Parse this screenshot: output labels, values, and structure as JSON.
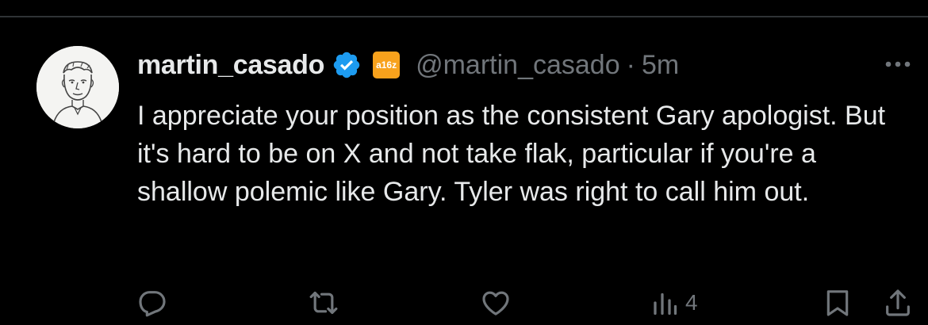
{
  "tweet": {
    "display_name": "martin_casado",
    "handle": "@martin_casado",
    "separator": "·",
    "time": "5m",
    "affiliate_badge_text": "a16z",
    "text": "I appreciate your position as the consistent Gary apologist. But it's hard to be on X and not take flak, particular if you're a shallow polemic like Gary. Tyler was right to call him out.",
    "stats": {
      "views": "4"
    }
  },
  "icons": {
    "verified": "verified-badge-icon",
    "more": "more-horizontal-icon",
    "reply": "reply-icon",
    "retweet": "retweet-icon",
    "like": "like-icon",
    "views": "views-icon",
    "bookmark": "bookmark-icon",
    "share": "share-icon"
  },
  "colors": {
    "background": "#000000",
    "text_primary": "#e7e9ea",
    "text_secondary": "#71767b",
    "verified_blue": "#1d9bf0",
    "affiliate_orange": "#f8a21c",
    "divider": "#2f3336"
  }
}
